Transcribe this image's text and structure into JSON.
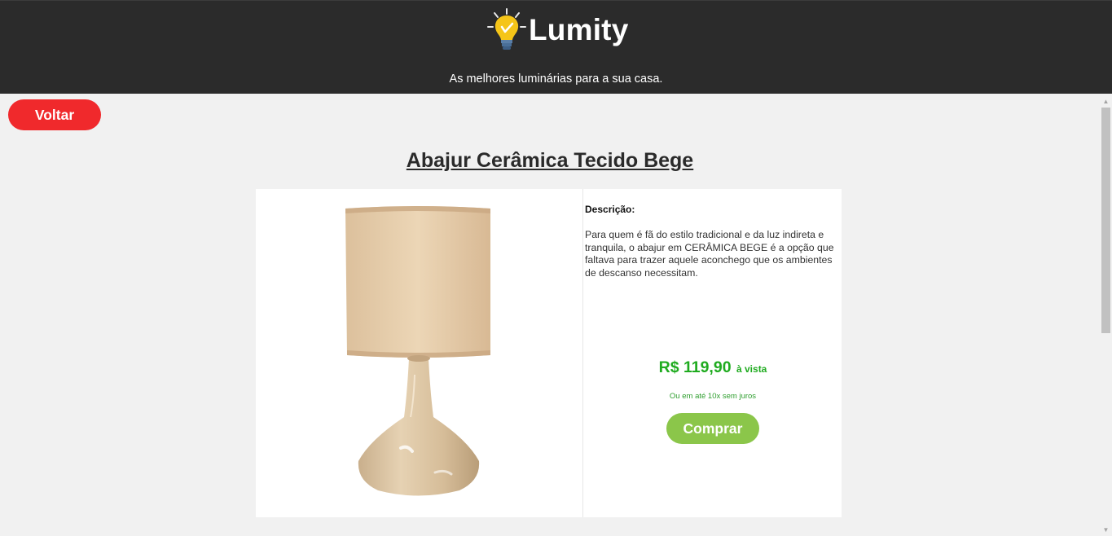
{
  "header": {
    "brand": "Lumity",
    "tagline": "As melhores luminárias para a sua casa.",
    "logo_icon": "lightbulb-icon"
  },
  "nav": {
    "back_label": "Voltar"
  },
  "product": {
    "title": "Abajur Cerâmica Tecido Bege",
    "description_label": "Descrição:",
    "description": "Para quem é fã do estilo tradicional e da luz indireta e tranquila, o abajur em CERÂMICA BEGE é a opção que faltava para trazer aquele aconchego que os ambientes de descanso necessitam.",
    "price": "R$ 119,90",
    "price_note": "à vista",
    "installments": "Ou em até 10x sem juros",
    "buy_label": "Comprar",
    "image_icon": "table-lamp-image"
  },
  "colors": {
    "header_bg": "#2b2b2b",
    "back_button": "#f0292c",
    "buy_button": "#8bc64a",
    "price": "#1fab1f",
    "page_bg": "#f1f1f1"
  }
}
